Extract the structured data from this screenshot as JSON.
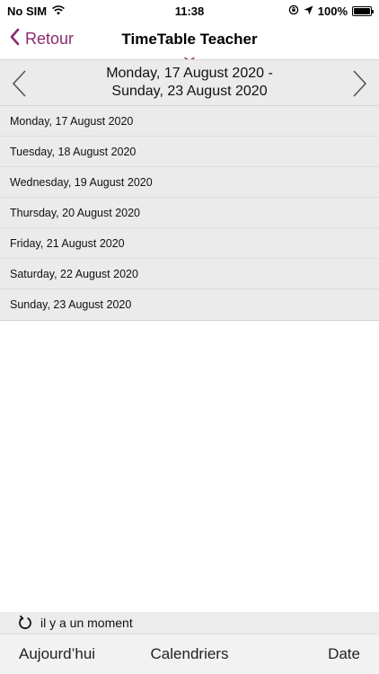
{
  "status_bar": {
    "carrier": "No SIM",
    "time": "11:38",
    "battery": "100%"
  },
  "nav": {
    "back_label": "Retour",
    "title": "TimeTable Teacher"
  },
  "week": {
    "line1": "Monday, 17 August 2020 -",
    "line2": "Sunday, 23 August 2020"
  },
  "days": [
    "Monday, 17 August 2020",
    "Tuesday, 18 August 2020",
    "Wednesday, 19 August 2020",
    "Thursday, 20 August 2020",
    "Friday, 21 August 2020",
    "Saturday, 22 August 2020",
    "Sunday, 23 August 2020"
  ],
  "refresh": {
    "text": "il y a un moment"
  },
  "toolbar": {
    "today": "Aujourd’hui",
    "calendars": "Calendriers",
    "date": "Date"
  },
  "colors": {
    "accent": "#8b2a6f",
    "row_bg": "#ebebeb"
  }
}
